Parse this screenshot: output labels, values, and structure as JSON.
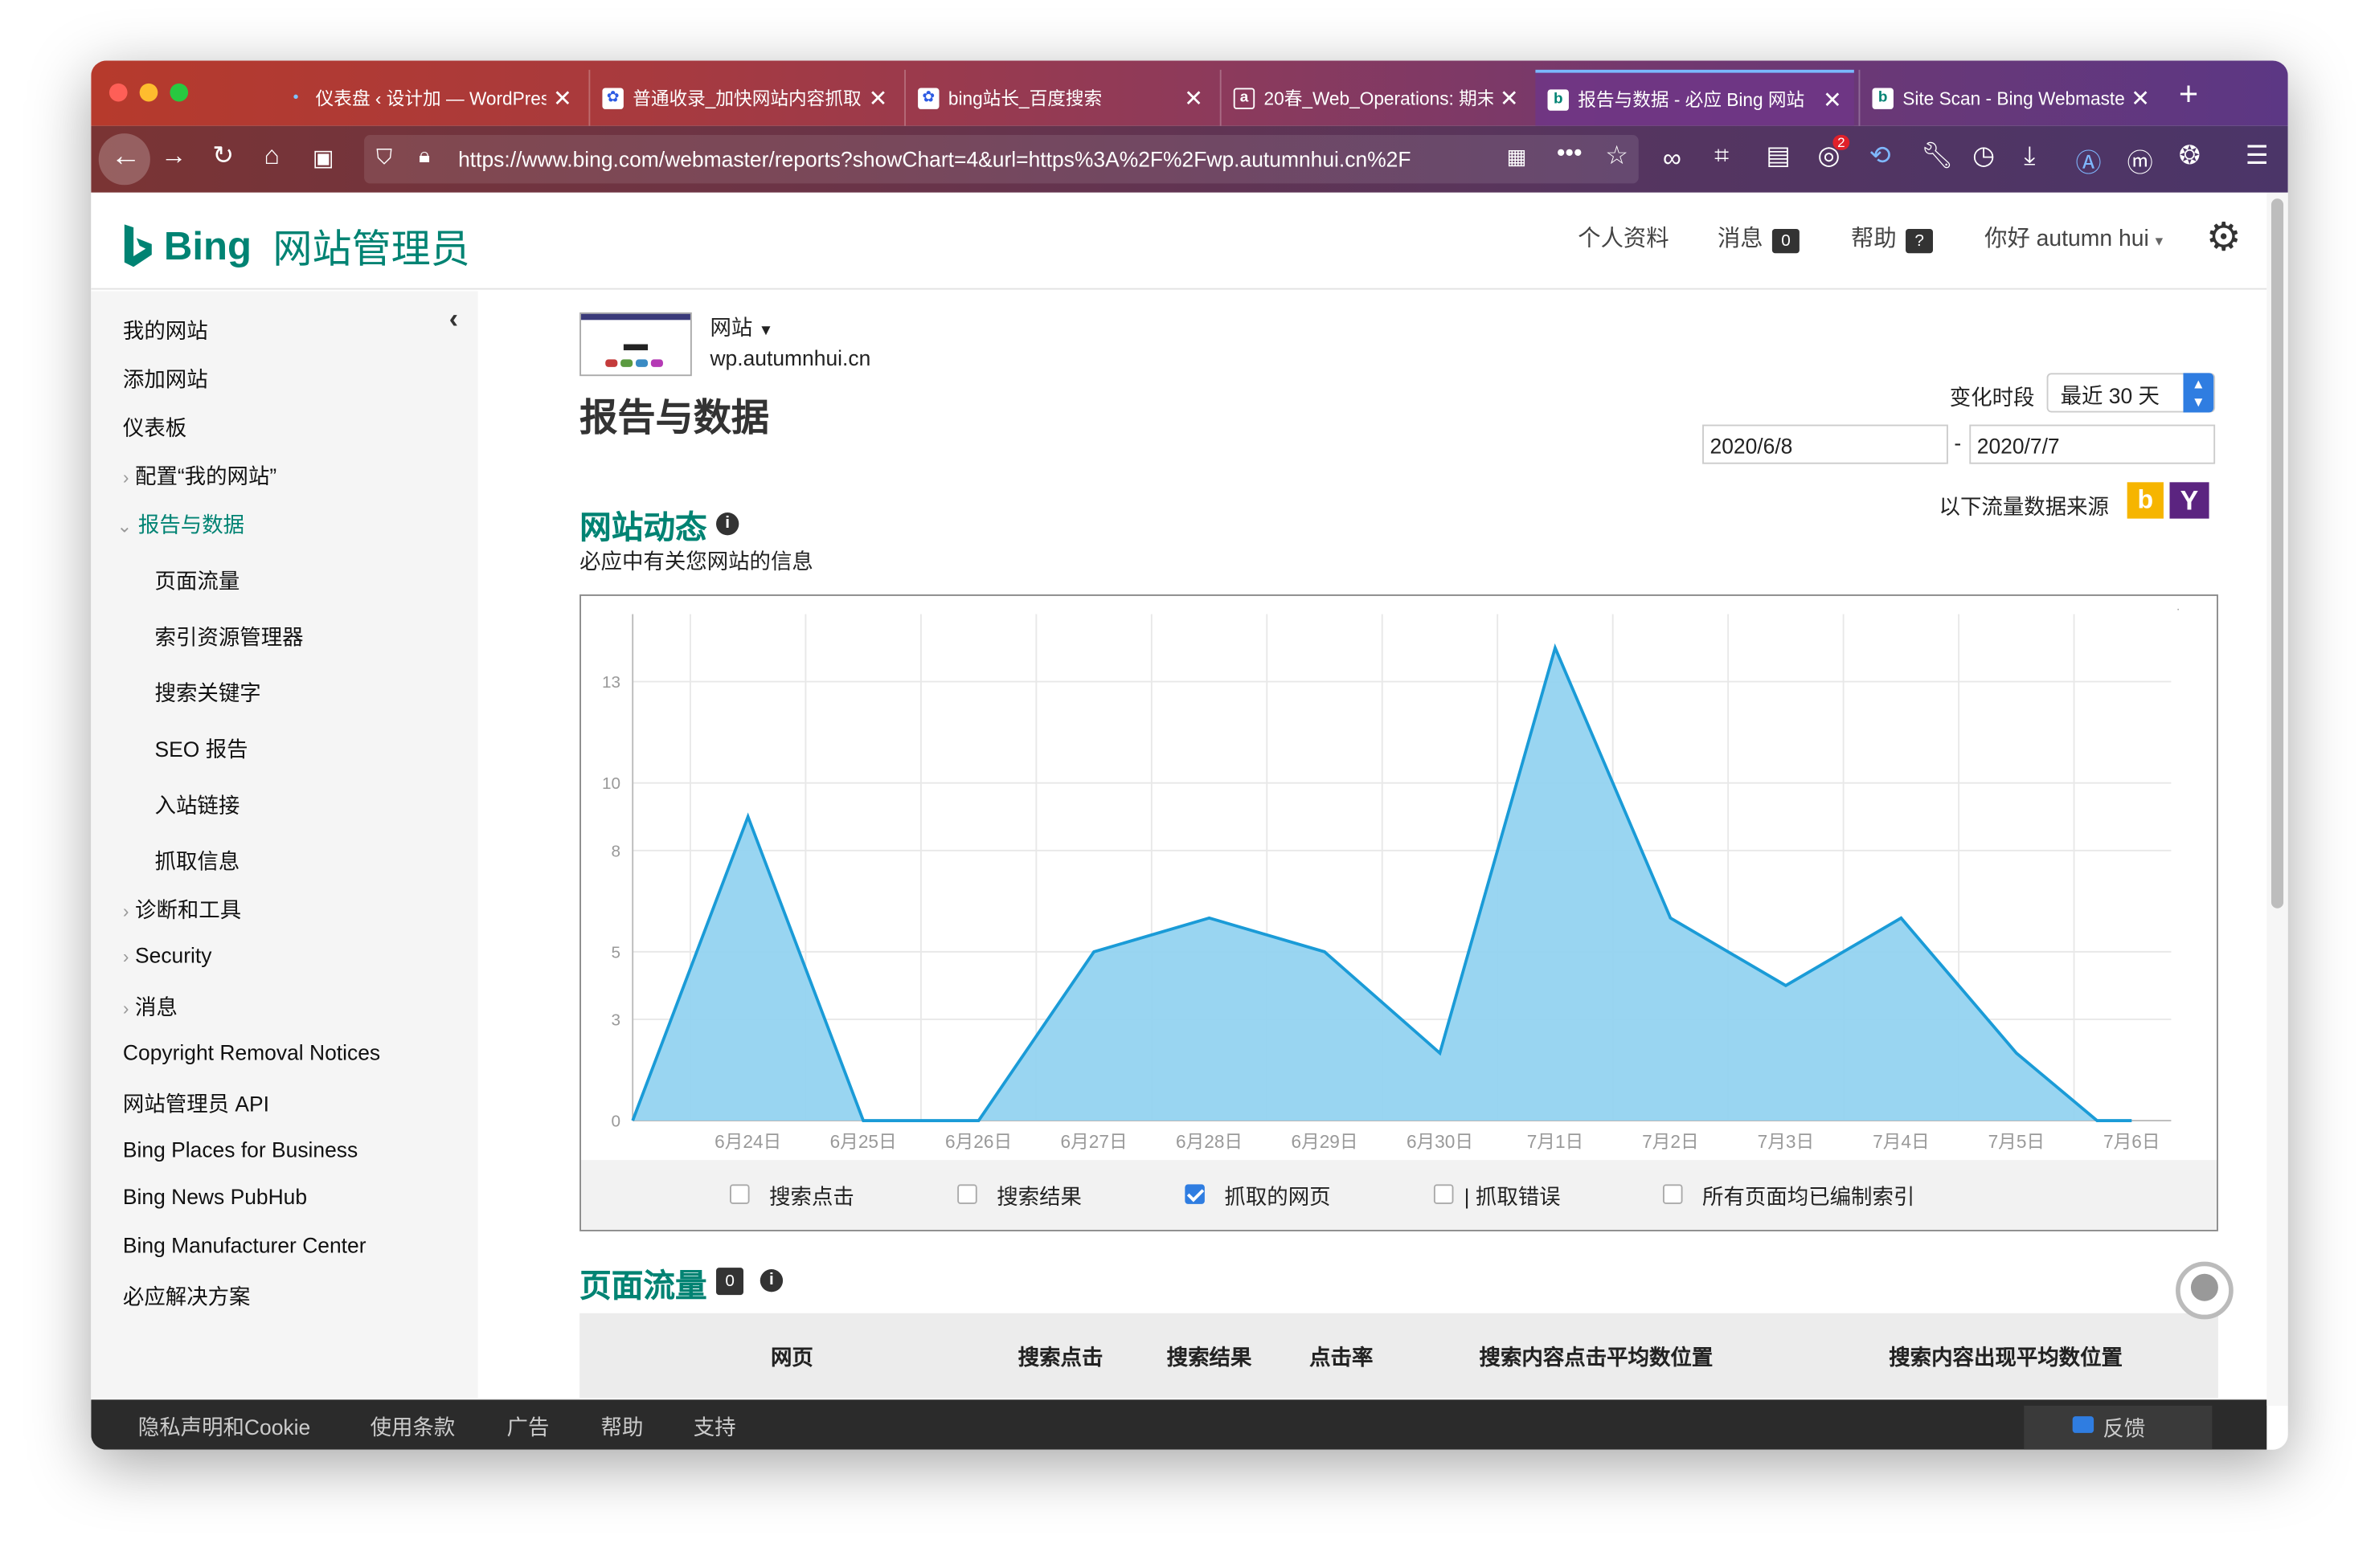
{
  "browser": {
    "tabs": [
      {
        "title": "仪表盘 ‹ 设计加 — WordPress",
        "icon": "wordpress-dot-icon"
      },
      {
        "title": "普通收录_加快网站内容抓取",
        "icon": "baidu-paw-icon"
      },
      {
        "title": "bing站长_百度搜索",
        "icon": "baidu-paw-icon"
      },
      {
        "title": "20春_Web_Operations: 期末",
        "icon": "canvas-icon"
      },
      {
        "title": "报告与数据 - 必应 Bing 网站",
        "icon": "bing-icon",
        "active": true
      },
      {
        "title": "Site Scan - Bing Webmaster",
        "icon": "bing-icon"
      }
    ],
    "url": "https://www.bing.com/webmaster/reports?showChart=4&url=https%3A%2F%2Fwp.autumnhui.cn%2F",
    "ext_badge": "2"
  },
  "header": {
    "brand": "Bing",
    "subtitle": "网站管理员",
    "profile": "个人资料",
    "messages": "消息",
    "messages_count": "0",
    "help": "帮助",
    "help_badge": "?",
    "greeting": "你好 autumn hui"
  },
  "sidebar": {
    "items": [
      {
        "label": "我的网站"
      },
      {
        "label": "添加网站"
      },
      {
        "label": "仪表板"
      },
      {
        "label": "配置“我的网站”"
      },
      {
        "label": "报告与数据"
      },
      {
        "label": "页面流量"
      },
      {
        "label": "索引资源管理器"
      },
      {
        "label": "搜索关键字"
      },
      {
        "label": "SEO 报告"
      },
      {
        "label": "入站链接"
      },
      {
        "label": "抓取信息"
      },
      {
        "label": "诊断和工具"
      },
      {
        "label": "Security"
      },
      {
        "label": "消息"
      },
      {
        "label": "Copyright Removal Notices"
      },
      {
        "label": "网站管理员 API"
      },
      {
        "label": "Bing Places for Business"
      },
      {
        "label": "Bing News PubHub"
      },
      {
        "label": "Bing Manufacturer Center"
      },
      {
        "label": "必应解决方案"
      }
    ]
  },
  "main": {
    "site_label": "网站",
    "site_url": "wp.autumnhui.cn",
    "page_title": "报告与数据",
    "period_label": "变化时段",
    "period_value": "最近 30 天",
    "date_from": "2020/6/8",
    "date_dash": "-",
    "date_to": "2020/7/7",
    "source_label": "以下流量数据来源",
    "section_title": "网站动态",
    "section_desc": "必应中有关您网站的信息",
    "legend": [
      "搜索点击",
      "搜索结果",
      "抓取的网页",
      "| 抓取错误",
      "所有页面均已编制索引"
    ],
    "traffic_title": "页面流量",
    "traffic_count": "0",
    "table_headers": [
      "网页",
      "搜索点击",
      "搜索结果",
      "点击率",
      "搜索内容点击平均数位置",
      "搜索内容出现平均数位置"
    ]
  },
  "footer": {
    "links": [
      "隐私声明和Cookie",
      "使用条款",
      "广告",
      "帮助",
      "支持"
    ],
    "feedback": "反馈"
  },
  "chart_data": {
    "type": "area",
    "categories": [
      "6月24日",
      "6月25日",
      "6月26日",
      "6月27日",
      "6月28日",
      "6月29日",
      "6月30日",
      "7月1日",
      "7月2日",
      "7月3日",
      "7月4日",
      "7月5日",
      "7月6日"
    ],
    "x_index": [
      0,
      1,
      2,
      3,
      4,
      5,
      6,
      7,
      8,
      9,
      10,
      11,
      12,
      13,
      14,
      15,
      16,
      17,
      18,
      19,
      20,
      21,
      22,
      23,
      24,
      25,
      26,
      27
    ],
    "series": [
      {
        "name": "抓取的网页",
        "values": [
          0,
          9,
          0,
          0,
          0,
          5,
          6,
          5,
          2,
          14,
          6,
          4,
          6,
          2,
          0,
          0
        ]
      }
    ],
    "point_x": [
      0,
      1,
      2,
      2.5,
      3,
      4,
      5,
      6,
      7,
      8,
      9,
      10,
      11,
      12,
      12.7,
      13
    ],
    "yticks": [
      0,
      3,
      5,
      8,
      10,
      13
    ],
    "ylim": [
      0,
      15
    ],
    "grid": true,
    "color": "#1a9bd7",
    "fill": "#93d3f0"
  }
}
